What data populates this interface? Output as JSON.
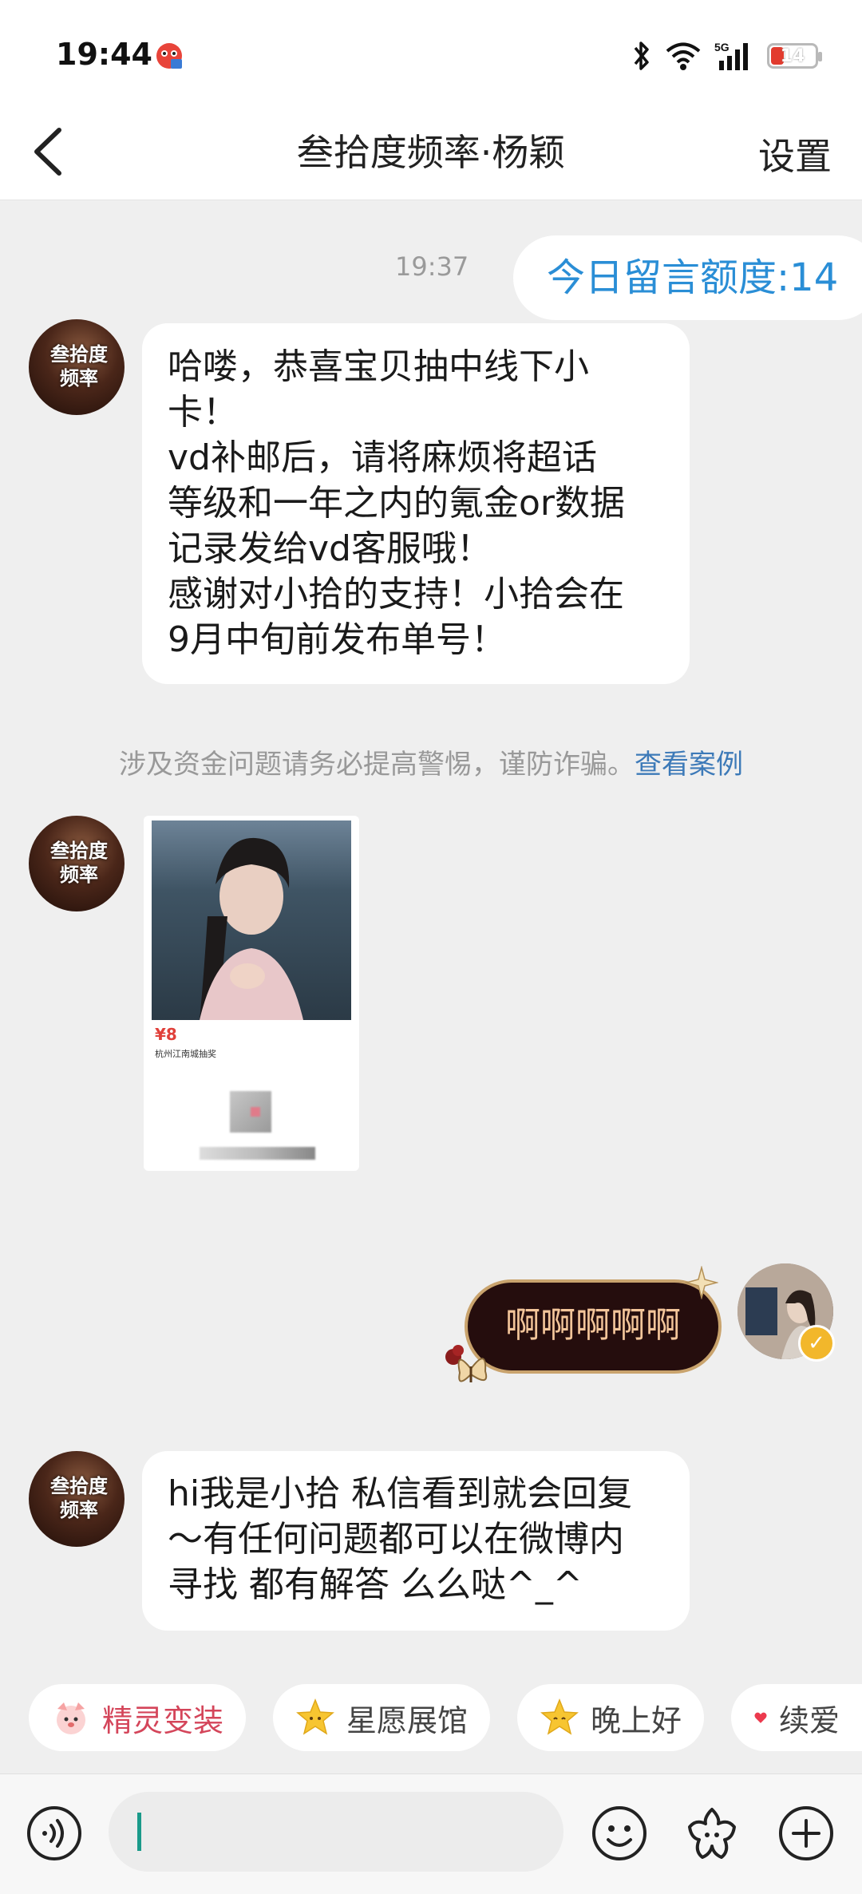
{
  "status": {
    "time": "19:44",
    "battery": "14"
  },
  "nav": {
    "title": "叁拾度频率·杨颖",
    "settings": "设置"
  },
  "chat": {
    "timestamp": "19:37",
    "quota_label": "今日留言额度:14",
    "contact_avatar": {
      "line1": "叁拾度",
      "line2": "频率"
    },
    "message1": "哈喽，恭喜宝贝抽中线下小\n卡！\nvd补邮后，请将麻烦将超话\n等级和一年之内的氪金or数据\n记录发给vd客服哦！\n感谢对小拾的支持！小拾会在\n9月中旬前发布单号！",
    "warning_text": "涉及资金问题请务必提高警惕，谨防诈骗。",
    "warning_link": "查看案例",
    "card": {
      "price": "¥8",
      "subtitle": "杭州江南城抽奖"
    },
    "my_message": "啊啊啊啊啊",
    "message3": "hi我是小拾 私信看到就会回复\n～有任何问题都可以在微博内\n寻找 都有解答 么么哒^_^"
  },
  "quick_chips": [
    {
      "label": "精灵变装",
      "icon": "fox-face-icon"
    },
    {
      "label": "星愿展馆",
      "icon": "star-face-icon"
    },
    {
      "label": "晚上好",
      "icon": "star-face-icon"
    },
    {
      "label": "续爱",
      "icon": "heart-icon"
    }
  ],
  "input": {
    "placeholder": ""
  },
  "colors": {
    "accent_blue": "#2a8ed6",
    "bubble_dark": "#250d0d",
    "gold": "#c9a36d"
  }
}
